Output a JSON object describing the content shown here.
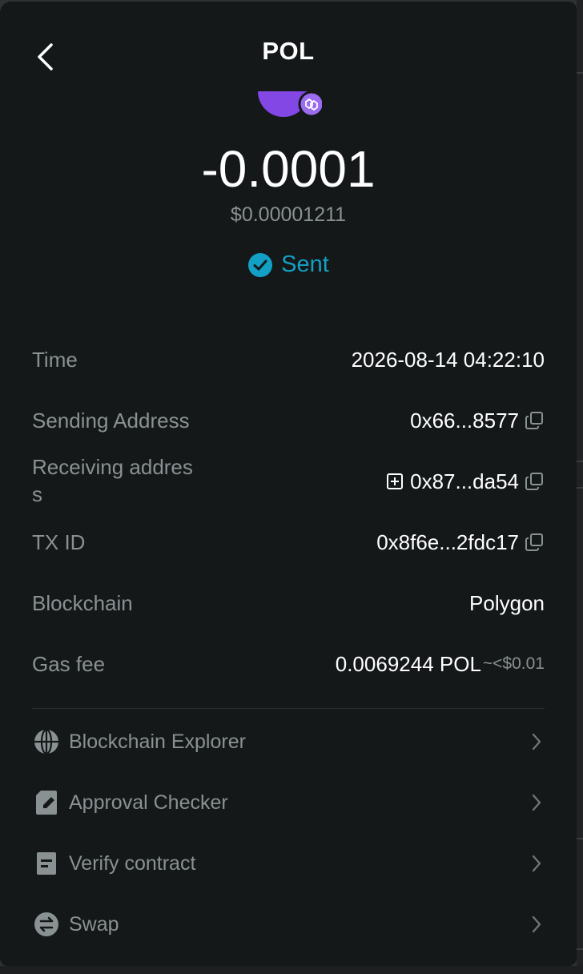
{
  "header": {
    "title": "POL",
    "back_icon": "chevron-left-icon"
  },
  "summary": {
    "token_icon": "polygon-icon",
    "amount": "-0.0001",
    "fiat_value": "$0.00001211",
    "status": "Sent",
    "status_icon": "check-circle-icon",
    "status_color": "#12a0c4"
  },
  "details": {
    "time": {
      "label": "Time",
      "value": "2026-08-14 04:22:10"
    },
    "sending": {
      "label": "Sending Address",
      "value": "0x66...8577"
    },
    "receiving": {
      "label_line1": "Receiving addres",
      "label_line2": "s",
      "value": "0x87...da54"
    },
    "txid": {
      "label": "TX ID",
      "value": "0x8f6e...2fdc17"
    },
    "blockchain": {
      "label": "Blockchain",
      "value": "Polygon"
    },
    "gas": {
      "label": "Gas fee",
      "value": "0.0069244 POL",
      "fiat": "~<$0.01"
    }
  },
  "links": [
    {
      "label": "Blockchain Explorer",
      "icon": "globe-icon"
    },
    {
      "label": "Approval Checker",
      "icon": "edit-document-icon"
    },
    {
      "label": "Verify contract",
      "icon": "contract-document-icon"
    },
    {
      "label": "Swap",
      "icon": "swap-icon"
    }
  ],
  "colors": {
    "background": "#141819",
    "accent": "#12a0c4",
    "token_purple": "#8247e5",
    "muted_text": "#8a9192"
  }
}
